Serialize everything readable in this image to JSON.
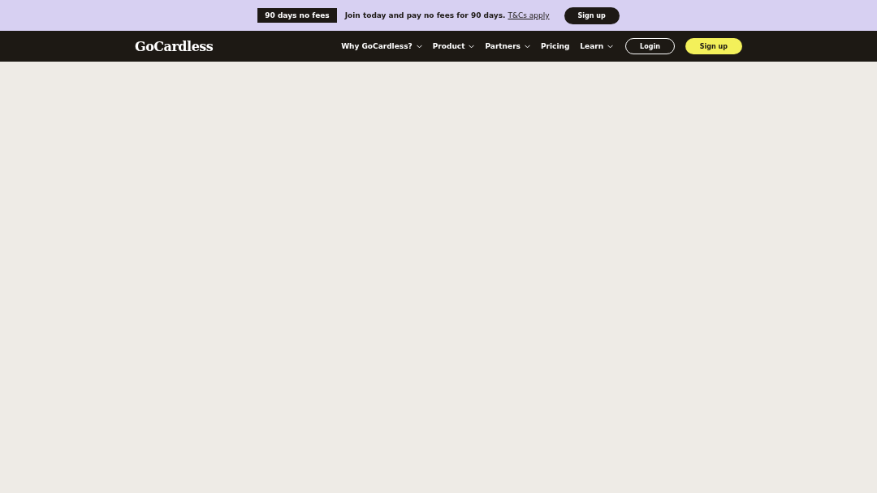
{
  "promo_bar": {
    "badge": "90 days no fees",
    "message": "Join today and pay no fees for 90 days.",
    "link": "T&Cs apply",
    "button": "Sign up"
  },
  "navbar": {
    "logo": "GoCardless",
    "items": [
      {
        "label": "Why GoCardless?",
        "has_menu": true
      },
      {
        "label": "Product",
        "has_menu": true
      },
      {
        "label": "Partners",
        "has_menu": true
      },
      {
        "label": "Pricing",
        "has_menu": false
      },
      {
        "label": "Learn",
        "has_menu": true
      }
    ],
    "login_button": "Login",
    "signup_button": "Sign up"
  }
}
